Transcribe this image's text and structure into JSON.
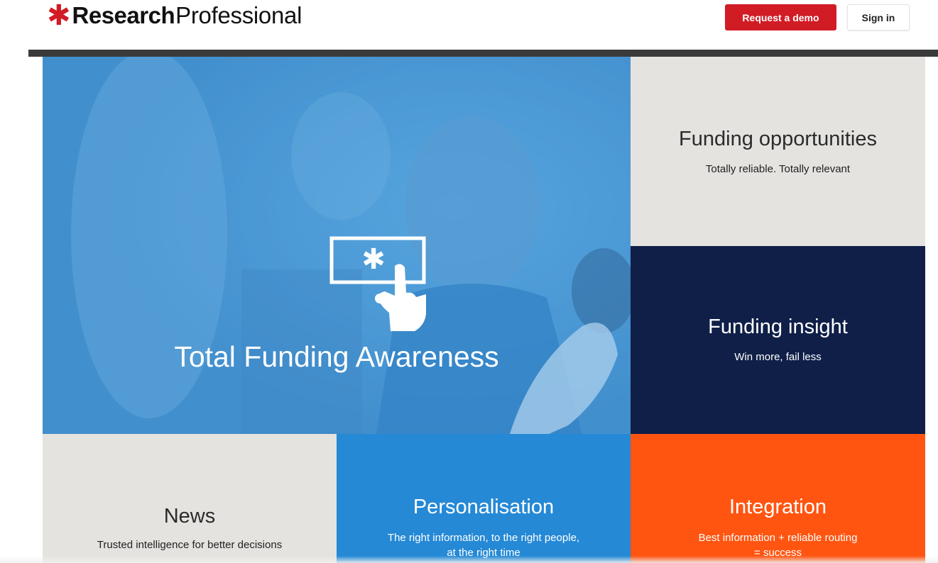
{
  "header": {
    "logo_bold": "Research",
    "logo_light": "Professional",
    "request_demo_label": "Request a demo",
    "sign_in_label": "Sign in"
  },
  "hero": {
    "title": "Total Funding Awareness"
  },
  "tiles": {
    "funding_opportunities": {
      "title": "Funding opportunities",
      "subtitle": "Totally reliable. Totally relevant"
    },
    "funding_insight": {
      "title": "Funding insight",
      "subtitle": "Win more, fail less"
    },
    "news": {
      "title": "News",
      "subtitle": "Trusted intelligence for better decisions"
    },
    "personalisation": {
      "title": "Personalisation",
      "line1": "The right information, to the right people,",
      "line2": "at the right time"
    },
    "integration": {
      "title": "Integration",
      "line1": "Best information + reliable routing",
      "line2": "= success"
    }
  },
  "colors": {
    "brand_red": "#d11c25",
    "hero_blue": "#4d9bd6",
    "navy": "#0f1f48",
    "light_grey": "#e4e3e0",
    "mid_blue": "#2589d6",
    "orange": "#ff5511"
  },
  "icons": {
    "logo_mark": "asterisk-icon",
    "hero_icon": "hand-pointing-screen-icon"
  }
}
